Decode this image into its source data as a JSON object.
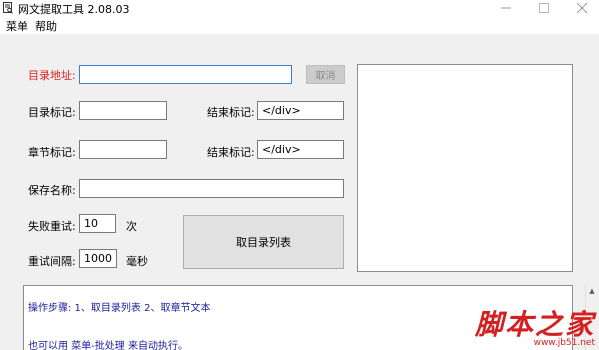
{
  "titlebar": {
    "title": "网文提取工具  2.08.03"
  },
  "menu": {
    "items": [
      "菜单",
      "帮助"
    ]
  },
  "form": {
    "catalog_url_label": "目录地址:",
    "catalog_url_value": "",
    "cancel_label": "取消",
    "catalog_mark_label": "目录标记:",
    "catalog_mark_value": "",
    "catalog_end_label": "结束标记:",
    "catalog_end_value": "</div>",
    "chapter_mark_label": "章节标记:",
    "chapter_mark_value": "",
    "chapter_end_label": "结束标记:",
    "chapter_end_value": "</div>",
    "save_name_label": "保存名称:",
    "save_name_value": "",
    "retry_label": "失败重试:",
    "retry_value": "10",
    "retry_unit": "次",
    "interval_label": "重试间隔:",
    "interval_value": "1000",
    "interval_unit": "毫秒",
    "fetch_catalog_label": "取目录列表"
  },
  "log": {
    "line1": "操作步骤:  1、取目录列表        2、取章节文本",
    "line2": "也可以用 菜单-批处理 来自动执行。"
  },
  "watermark": {
    "main": "脚本之家",
    "sub": "www.jb51.net"
  },
  "colors": {
    "accent_red": "#e02020",
    "log_text": "#1c1c9c",
    "focus_border": "#3c7fd6"
  }
}
